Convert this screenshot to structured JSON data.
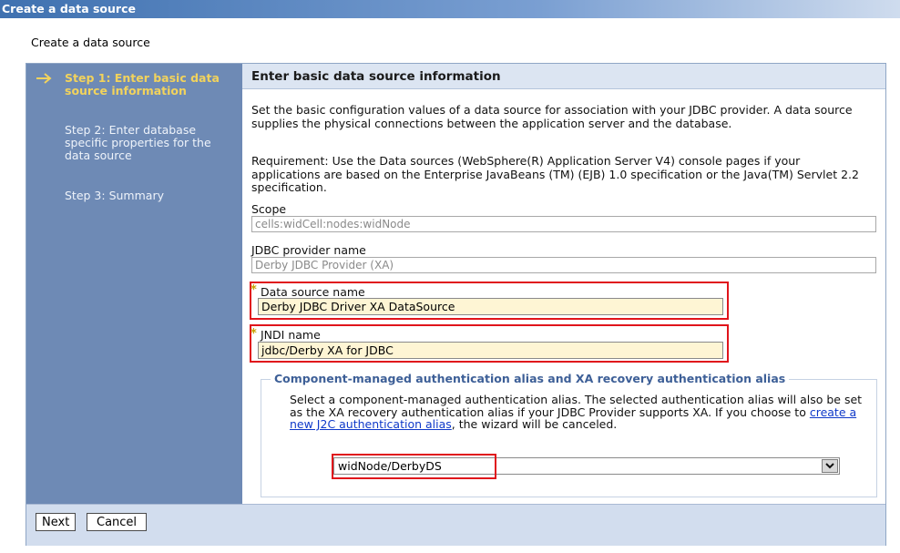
{
  "window": {
    "title": "Create a data source"
  },
  "page": {
    "subtitle": "Create a data source"
  },
  "steps": [
    {
      "label": "Step 1: Enter basic data source information",
      "active": true
    },
    {
      "label": "Step 2: Enter database specific properties for the data source",
      "active": false
    },
    {
      "label": "Step 3: Summary",
      "active": false
    }
  ],
  "main": {
    "heading": "Enter basic data source information",
    "description": "Set the basic configuration values of a data source for association with your JDBC provider. A data source supplies the physical connections between the application server and the database.",
    "requirement": "Requirement: Use the Data sources (WebSphere(R) Application Server V4) console pages if your applications are based on the Enterprise JavaBeans (TM) (EJB) 1.0 specification or the Java(TM) Servlet 2.2 specification.",
    "scope": {
      "label": "Scope",
      "value": "cells:widCell:nodes:widNode"
    },
    "provider": {
      "label": "JDBC provider name",
      "value": "Derby JDBC Provider (XA)"
    },
    "datasource_name": {
      "label": "Data source name",
      "value": "Derby JDBC Driver XA DataSource"
    },
    "jndi_name": {
      "label": "JNDI name",
      "value": "jdbc/Derby XA for JDBC"
    },
    "auth_group": {
      "legend": "Component-managed authentication alias and XA recovery authentication alias",
      "text_before": "Select a component-managed authentication alias. The selected authentication alias will also be set as the XA recovery authentication alias if your JDBC Provider supports XA. If you choose to ",
      "link": "create a new J2C authentication alias",
      "text_after": ", the wizard will be canceled.",
      "selected": "widNode/DerbyDS"
    }
  },
  "footer": {
    "next_label": "Next",
    "cancel_label": "Cancel"
  },
  "colors": {
    "highlight": "#e0141b",
    "step_active": "#f2d35c",
    "sidebar": "#6e8ab5",
    "required_bg": "#fef5d4"
  }
}
